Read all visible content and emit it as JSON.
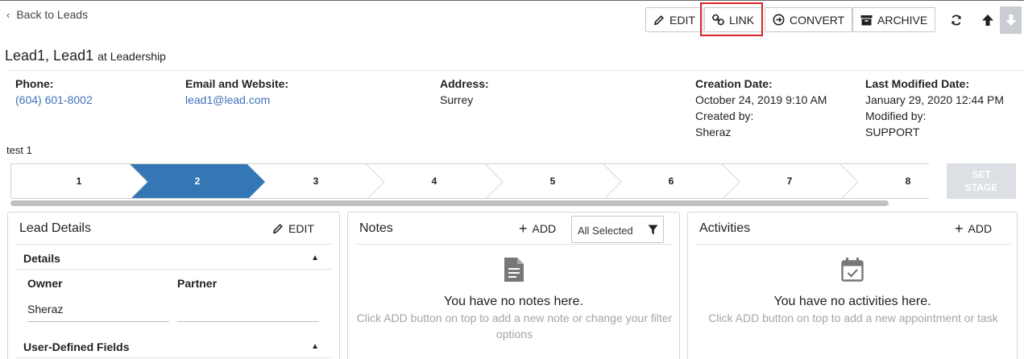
{
  "nav": {
    "back_label": "Back to Leads"
  },
  "toolbar": {
    "edit_label": "EDIT",
    "link_label": "LINK",
    "convert_label": "CONVERT",
    "archive_label": "ARCHIVE"
  },
  "lead": {
    "name": "Lead1, Lead1",
    "at_text": "at Leadership",
    "description": "test 1"
  },
  "info": {
    "phone_label": "Phone:",
    "phone_value": "(604) 601-8002",
    "email_label": "Email and Website:",
    "email_value": "lead1@lead.com",
    "address_label": "Address:",
    "address_value": "Surrey",
    "created_label": "Creation Date:",
    "created_value": "October 24, 2019 9:10 AM",
    "created_by_label": "Created by:",
    "created_by_value": "Sheraz",
    "modified_label": "Last Modified Date:",
    "modified_value": "January 29, 2020 12:44 PM",
    "modified_by_label": "Modified by:",
    "modified_by_value": "SUPPORT"
  },
  "stages": {
    "items": [
      "1",
      "2",
      "3",
      "4",
      "5",
      "6",
      "7",
      "8"
    ],
    "active": "2",
    "active_color": "#3377b5",
    "set_stage_line1": "SET",
    "set_stage_line2": "STAGE"
  },
  "lead_details": {
    "title": "Lead Details",
    "edit_label": "EDIT",
    "details_section": "Details",
    "owner_label": "Owner",
    "owner_value": "Sheraz",
    "partner_label": "Partner",
    "partner_value": "",
    "udf_section": "User-Defined Fields"
  },
  "notes": {
    "title": "Notes",
    "add_label": "ADD",
    "filter_value": "All Selected",
    "empty_title": "You have no notes here.",
    "empty_sub_line1": "Click ADD button on top to add a new note or change your filter",
    "empty_sub_line2": "options"
  },
  "activities": {
    "title": "Activities",
    "add_label": "ADD",
    "empty_title": "You have no activities here.",
    "empty_sub": "Click ADD button on top to add a new appointment or task"
  },
  "colors": {
    "link": "#3f73b8",
    "highlight": "#d8232a",
    "muted": "#a5a5a5"
  }
}
